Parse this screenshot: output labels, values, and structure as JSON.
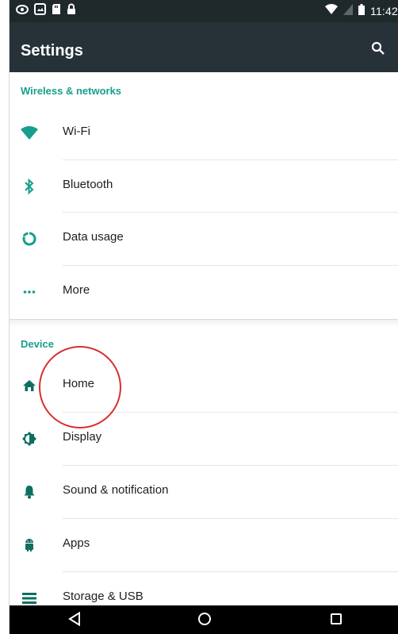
{
  "status_bar": {
    "time": "11:42",
    "left_icons": [
      "eye-icon",
      "image-icon",
      "sd-card-icon",
      "lock-icon"
    ],
    "right_icons": [
      "wifi-icon",
      "signal-icon",
      "battery-icon"
    ]
  },
  "app_bar": {
    "title": "Settings",
    "search_icon": "search-icon"
  },
  "sections": [
    {
      "header": "Wireless & networks",
      "items": [
        {
          "label": "Wi-Fi",
          "icon": "wifi-icon"
        },
        {
          "label": "Bluetooth",
          "icon": "bluetooth-icon"
        },
        {
          "label": "Data usage",
          "icon": "data-usage-icon"
        },
        {
          "label": "More",
          "icon": "more-icon"
        }
      ]
    },
    {
      "header": "Device",
      "items": [
        {
          "label": "Home",
          "icon": "home-icon"
        },
        {
          "label": "Display",
          "icon": "display-icon"
        },
        {
          "label": "Sound & notification",
          "icon": "bell-icon"
        },
        {
          "label": "Apps",
          "icon": "android-icon"
        },
        {
          "label": "Storage & USB",
          "icon": "storage-icon"
        }
      ]
    }
  ],
  "nav_bar": {
    "buttons": [
      "back-icon",
      "home-circle-icon",
      "recents-icon"
    ]
  },
  "colors": {
    "accent": "#159f8c",
    "app_bar": "#263238",
    "status_bar": "#1f292b",
    "annotation": "#d92e2e"
  }
}
